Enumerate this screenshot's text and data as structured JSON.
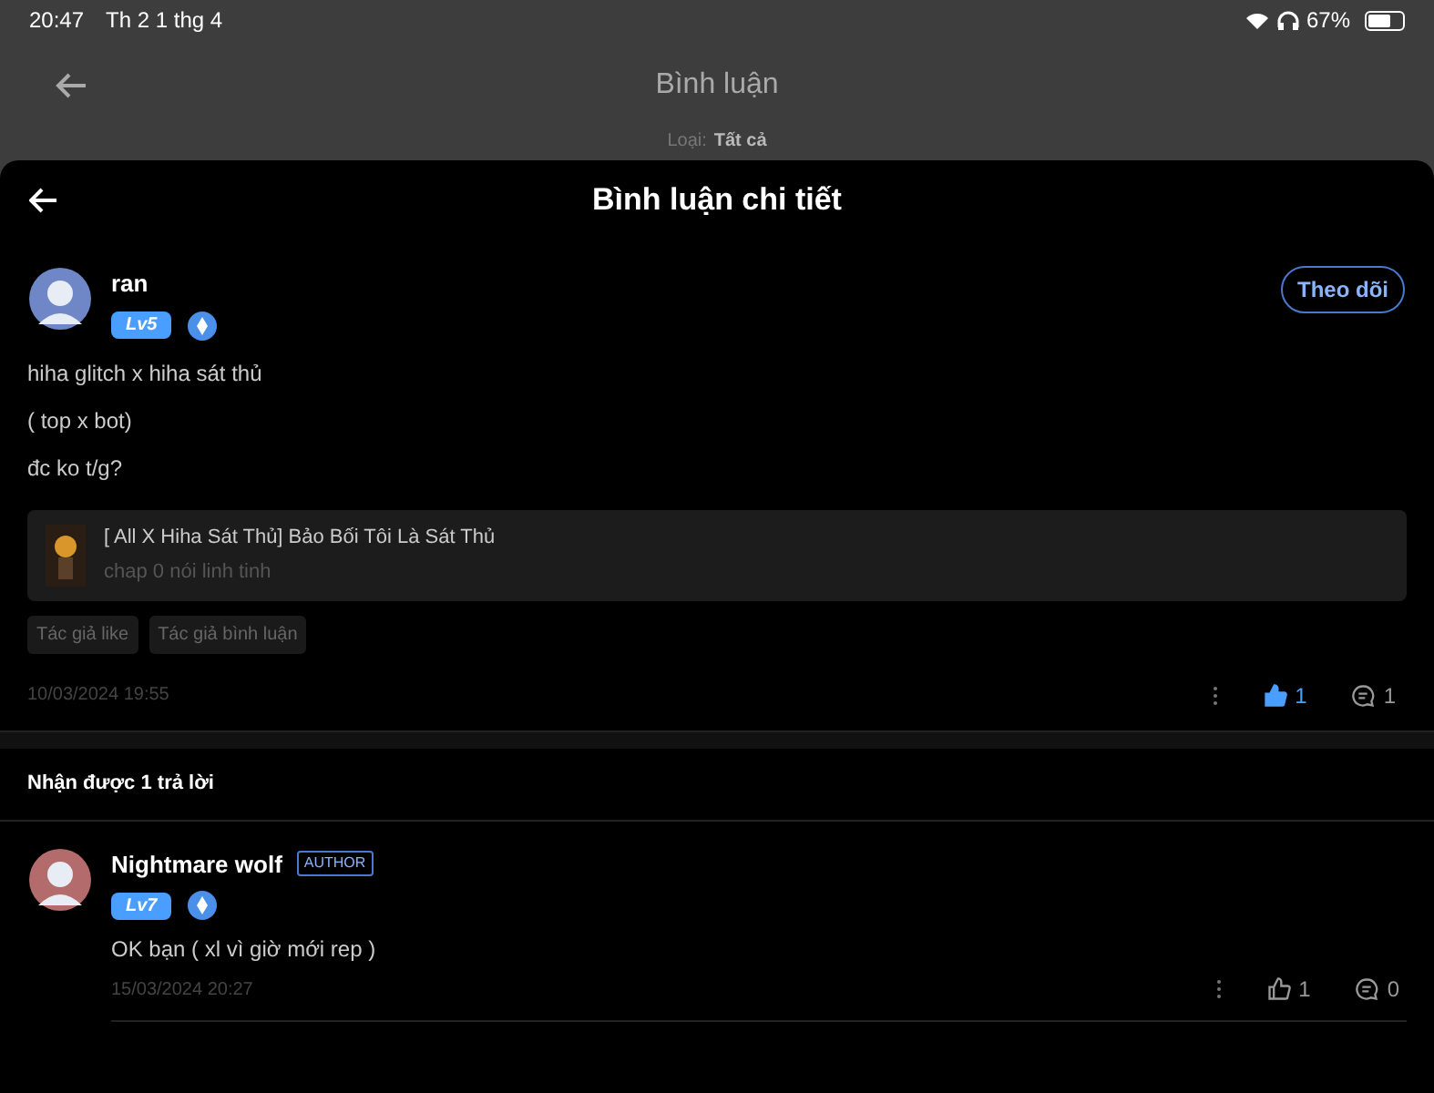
{
  "status_bar": {
    "time": "20:47",
    "date": "Th 2 1 thg 4",
    "battery": "67%"
  },
  "page": {
    "title": "Bình luận",
    "filter_label": "Loại:",
    "filter_value": "Tất cả"
  },
  "sheet": {
    "title": "Bình luận chi tiết"
  },
  "comment": {
    "user": "ran",
    "level": "Lv5",
    "follow": "Theo dõi",
    "lines": [
      "hiha glitch x hiha sát thủ",
      "( top x bot)",
      "đc ko t/g?"
    ],
    "story": {
      "title": "[ All X Hiha Sát Thủ] Bảo Bối Tôi Là Sát Thủ",
      "chapter": "chap 0 nói linh tinh"
    },
    "tags": [
      "Tác giả like",
      "Tác giả bình luận"
    ],
    "time": "10/03/2024 19:55",
    "likes": "1",
    "liked": true,
    "replies": "1"
  },
  "replies_heading": "Nhận được 1 trả lời",
  "replies": [
    {
      "user": "Nightmare wolf",
      "badge": "AUTHOR",
      "level": "Lv7",
      "text": "OK bạn ( xl vì giờ mới rep )",
      "time": "15/03/2024 20:27",
      "likes": "1",
      "liked": false,
      "replies": "0"
    }
  ]
}
